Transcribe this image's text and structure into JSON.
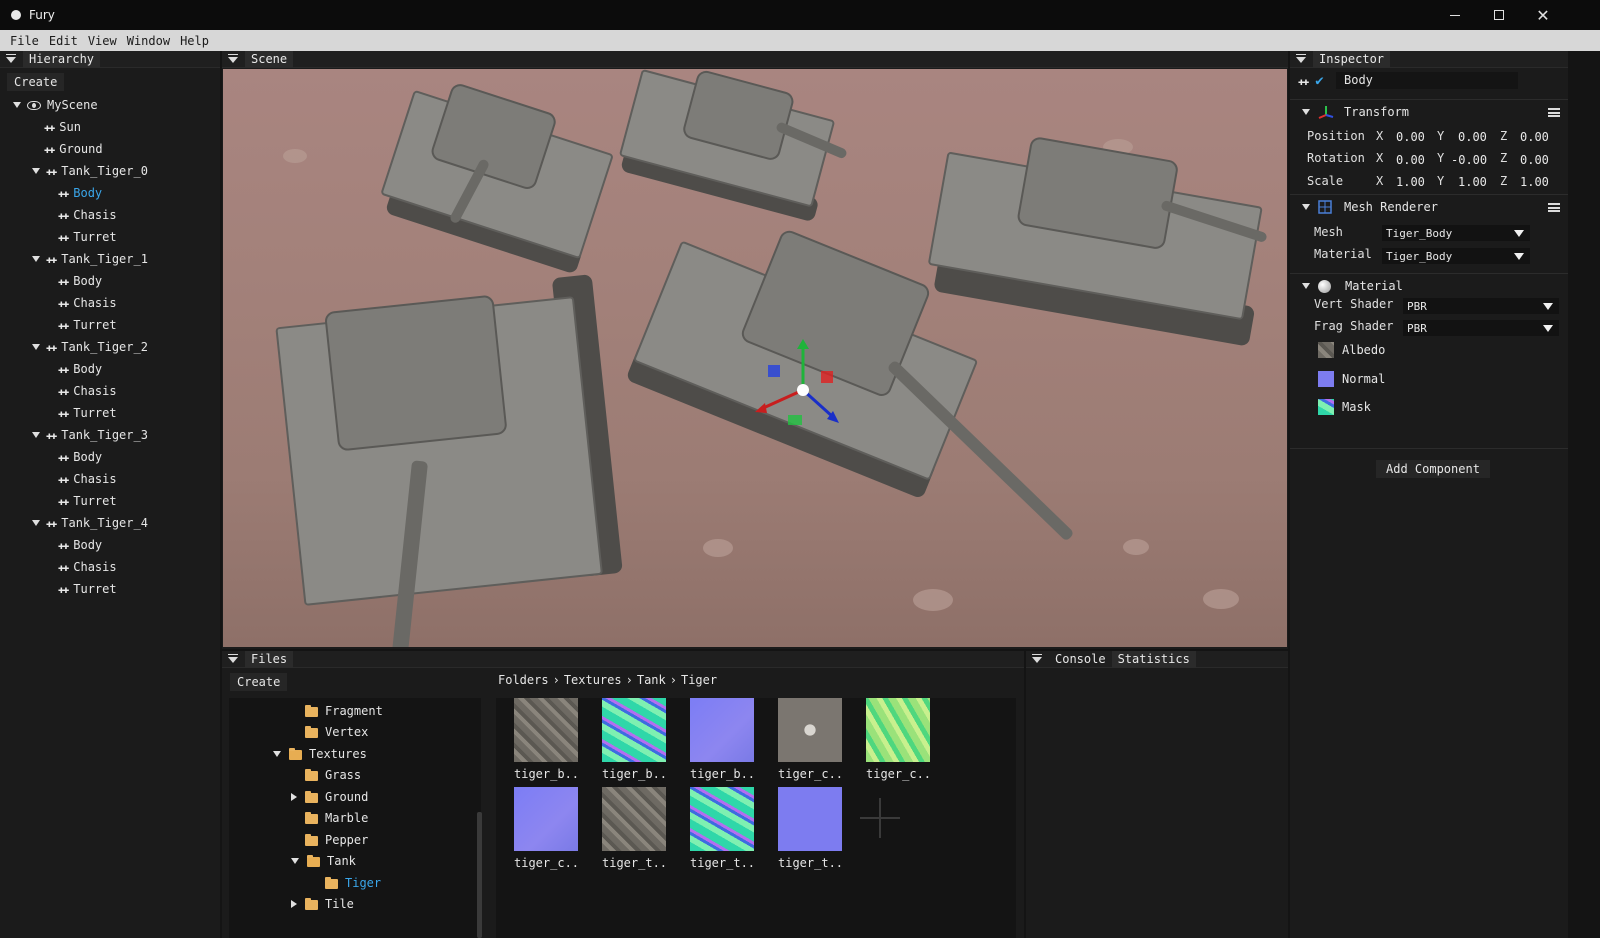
{
  "window": {
    "title": "Fury"
  },
  "menu": [
    "File",
    "Edit",
    "View",
    "Window",
    "Help"
  ],
  "hierarchy": {
    "title": "Hierarchy",
    "create_label": "Create",
    "scene_name": "MyScene",
    "nodes": [
      {
        "label": "Sun"
      },
      {
        "label": "Ground"
      },
      {
        "label": "Tank_Tiger_0",
        "children": [
          "Body",
          "Chasis",
          "Turret"
        ]
      },
      {
        "label": "Tank_Tiger_1",
        "children": [
          "Body",
          "Chasis",
          "Turret"
        ]
      },
      {
        "label": "Tank_Tiger_2",
        "children": [
          "Body",
          "Chasis",
          "Turret"
        ]
      },
      {
        "label": "Tank_Tiger_3",
        "children": [
          "Body",
          "Chasis",
          "Turret"
        ]
      },
      {
        "label": "Tank_Tiger_4",
        "children": [
          "Body",
          "Chasis",
          "Turret"
        ]
      }
    ],
    "selected": "Body"
  },
  "scene": {
    "title": "Scene"
  },
  "inspector": {
    "title": "Inspector",
    "object_name": "Body",
    "transform": {
      "title": "Transform",
      "position_label": "Position",
      "rotation_label": "Rotation",
      "scale_label": "Scale",
      "axis_x": "X",
      "axis_y": "Y",
      "axis_z": "Z",
      "position": [
        "0.00",
        "0.00",
        "0.00"
      ],
      "rotation": [
        "0.00",
        "-0.00",
        "0.00"
      ],
      "scale": [
        "1.00",
        "1.00",
        "1.00"
      ]
    },
    "mesh_renderer": {
      "title": "Mesh Renderer",
      "mesh_label": "Mesh",
      "mesh_value": "Tiger_Body",
      "material_label": "Material",
      "material_value": "Tiger_Body"
    },
    "material": {
      "title": "Material",
      "vert_label": "Vert Shader",
      "vert_value": "PBR",
      "frag_label": "Frag Shader",
      "frag_value": "PBR",
      "textures": [
        "Albedo",
        "Normal",
        "Mask"
      ]
    },
    "add_component_label": "Add Component"
  },
  "files": {
    "title": "Files",
    "create_label": "Create",
    "breadcrumb": [
      "Folders",
      "Textures",
      "Tank",
      "Tiger"
    ],
    "tree": [
      {
        "label": "Fragment"
      },
      {
        "label": "Vertex"
      },
      {
        "label": "Textures"
      },
      {
        "label": "Grass"
      },
      {
        "label": "Ground"
      },
      {
        "label": "Marble"
      },
      {
        "label": "Pepper"
      },
      {
        "label": "Tank"
      },
      {
        "label": "Tiger"
      },
      {
        "label": "Tile"
      }
    ],
    "assets": [
      "tiger_b..",
      "tiger_b..",
      "tiger_b..",
      "tiger_c..",
      "tiger_c..",
      "tiger_c..",
      "tiger_t..",
      "tiger_t..",
      "tiger_t.."
    ]
  },
  "console": {
    "tabs": [
      "Console",
      "Statistics"
    ]
  },
  "colors": {
    "selected_text": "#3aa6ea",
    "folder": "#e9b35e",
    "menu_bg": "#d7d7d7",
    "panel_bg": "#1b1b1b"
  },
  "icons": {
    "hierarchy_node": "node-crosshair-icon",
    "scene_visibility": "eye-icon",
    "folder": "folder-icon",
    "add_asset": "plus-icon"
  }
}
